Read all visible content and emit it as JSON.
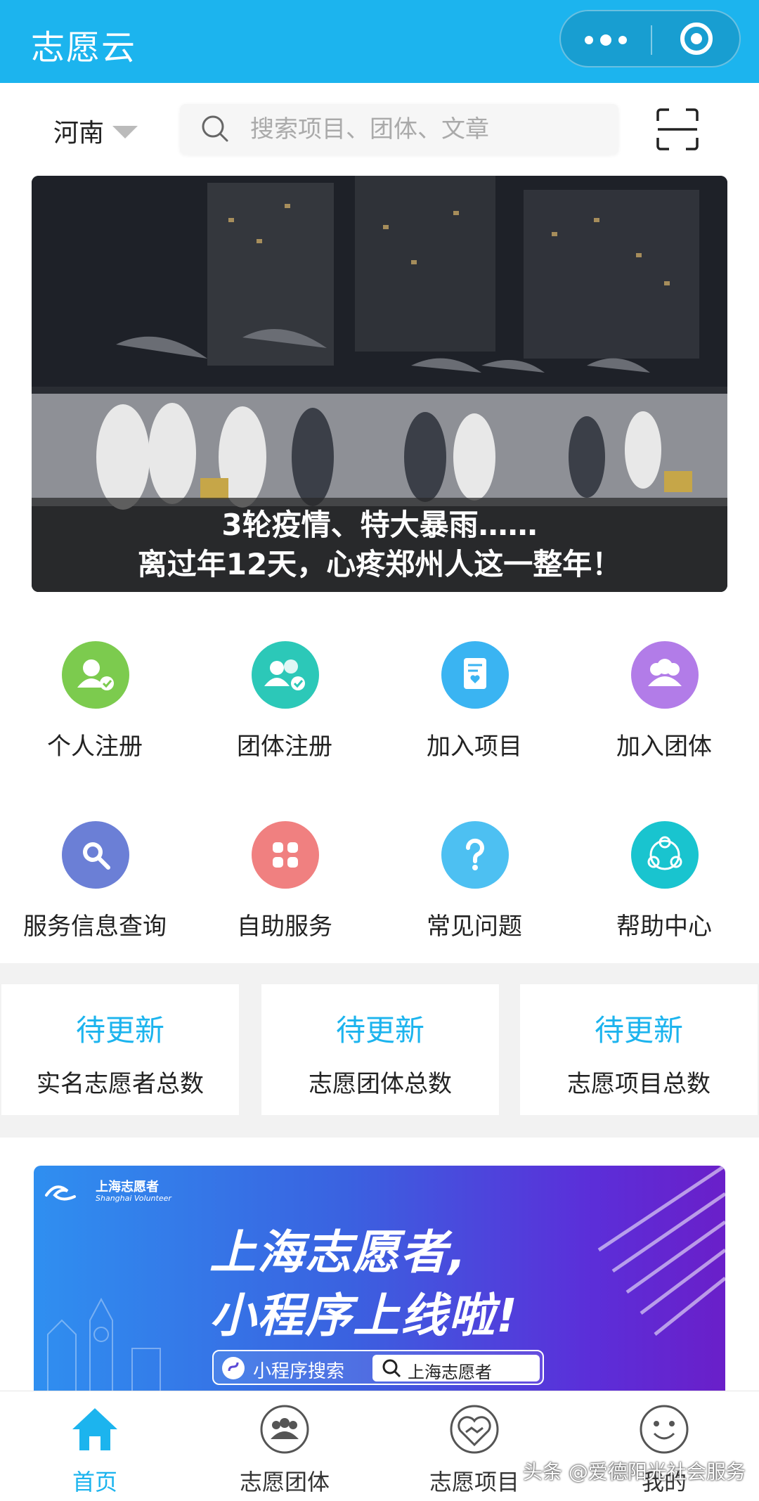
{
  "header": {
    "title": "志愿云"
  },
  "location": {
    "region": "河南"
  },
  "search": {
    "placeholder": "搜索项目、团体、文章"
  },
  "banner": {
    "caption_line1": "3轮疫情、特大暴雨……",
    "caption_line2": "离过年12天，心疼郑州人这一整年！"
  },
  "grid": [
    {
      "label": "个人注册",
      "icon": "person-check-icon",
      "color": "#7ccb4e"
    },
    {
      "label": "团体注册",
      "icon": "group-check-icon",
      "color": "#2cc8b8"
    },
    {
      "label": "加入项目",
      "icon": "document-heart-icon",
      "color": "#3ab4f2"
    },
    {
      "label": "加入团体",
      "icon": "group-icon",
      "color": "#b27ce8"
    },
    {
      "label": "服务信息查询",
      "icon": "search-icon",
      "color": "#6b7fd6"
    },
    {
      "label": "自助服务",
      "icon": "heart-clover-icon",
      "color": "#f08080"
    },
    {
      "label": "常见问题",
      "icon": "question-icon",
      "color": "#4dc0f2"
    },
    {
      "label": "帮助中心",
      "icon": "network-icon",
      "color": "#19c4cf"
    }
  ],
  "stats": [
    {
      "value": "待更新",
      "label": "实名志愿者总数"
    },
    {
      "value": "待更新",
      "label": "志愿团体总数"
    },
    {
      "value": "待更新",
      "label": "志愿项目总数"
    }
  ],
  "promo": {
    "logo": "上海志愿者",
    "logo_sub": "Shanghai Volunteer",
    "line1": "上海志愿者,",
    "line2": "小程序上线啦!",
    "search_prefix": "小程序搜索",
    "search_term": "上海志愿者"
  },
  "tabs": [
    {
      "label": "首页",
      "active": true
    },
    {
      "label": "志愿团体",
      "active": false
    },
    {
      "label": "志愿项目",
      "active": false
    },
    {
      "label": "我的",
      "active": false
    }
  ],
  "watermark": "头条 @爱德阳光社会服务",
  "colors": {
    "primary": "#1cb4ee",
    "stat_value": "#1cb4ee"
  }
}
